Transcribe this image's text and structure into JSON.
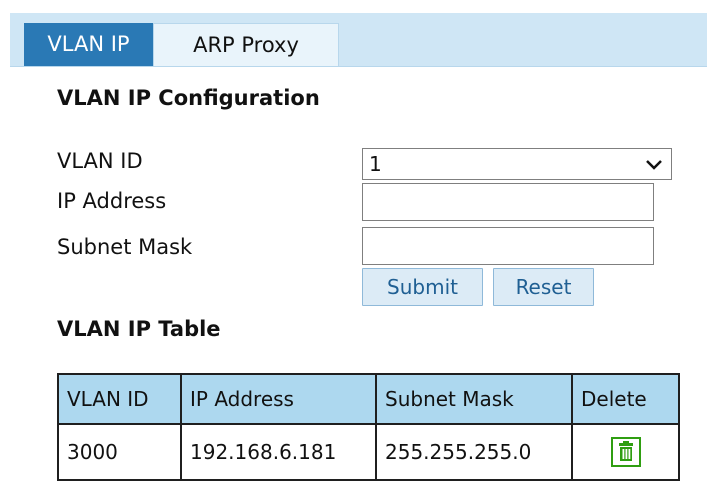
{
  "tabs": [
    {
      "label": "VLAN IP",
      "active": true
    },
    {
      "label": "ARP Proxy",
      "active": false
    }
  ],
  "config_section": {
    "title": "VLAN IP Configuration",
    "vlan_id_label": "VLAN ID",
    "vlan_id_value": "1",
    "ip_address_label": "IP Address",
    "ip_address_value": "",
    "subnet_mask_label": "Subnet Mask",
    "subnet_mask_value": "",
    "submit_label": "Submit",
    "reset_label": "Reset"
  },
  "table_section": {
    "title": "VLAN IP Table",
    "headers": [
      "VLAN ID",
      "IP Address",
      "Subnet Mask",
      "Delete"
    ],
    "rows": [
      {
        "vlan_id": "3000",
        "ip_address": "192.168.6.181",
        "subnet_mask": "255.255.255.0",
        "delete_icon": "trash-icon"
      }
    ]
  },
  "colors": {
    "tab_bar_bg": "#cfe6f5",
    "active_tab_bg": "#2a79b5",
    "table_header_bg": "#add8ef",
    "button_text": "#1f5f93",
    "trash_icon": "#2f9e11"
  }
}
